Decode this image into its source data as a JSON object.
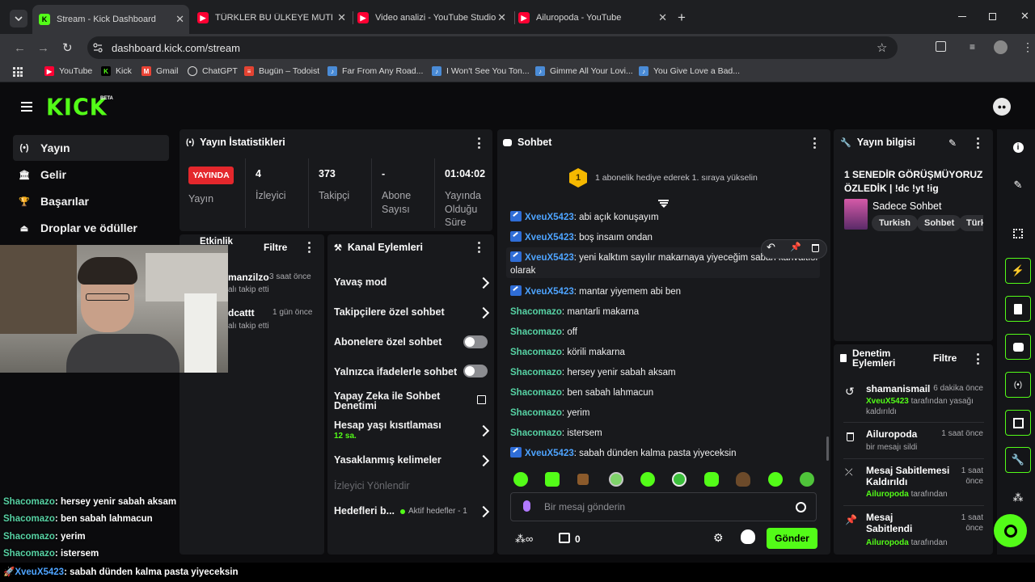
{
  "browser": {
    "tabs": [
      {
        "title": "Stream - Kick Dashboard",
        "icon": "kick-icon"
      },
      {
        "title": "TÜRKLER BU ÜLKEYE MUTLAKA",
        "icon": "youtube-icon"
      },
      {
        "title": "Video analizi - YouTube Studio",
        "icon": "youtube-icon"
      },
      {
        "title": "Ailuropoda - YouTube",
        "icon": "youtube-icon"
      }
    ],
    "url": "dashboard.kick.com/stream",
    "bookmarks": [
      "YouTube",
      "Kick",
      "Gmail",
      "ChatGPT",
      "Bugün – Todoist",
      "Far From Any Road...",
      "I Won't See You Ton...",
      "Gimme All Your Lovi...",
      "You Give Love a Bad..."
    ]
  },
  "header": {
    "logo": "KICK",
    "beta": "BETA"
  },
  "sidebar": {
    "items": [
      {
        "label": "Yayın",
        "icon": "broadcast-icon"
      },
      {
        "label": "Gelir",
        "icon": "bank-icon"
      },
      {
        "label": "Başarılar",
        "icon": "trophy-icon"
      },
      {
        "label": "Droplar ve ödüller",
        "icon": "drops-icon"
      }
    ]
  },
  "stats": {
    "title": "Yayın İstatistikleri",
    "live_badge": "YAYINDA",
    "live_label": "Yayın",
    "items": [
      {
        "value": "4",
        "label": "İzleyici"
      },
      {
        "value": "373",
        "label": "Takipçi"
      },
      {
        "value": "-",
        "label": "Abone Sayısı"
      },
      {
        "value": "01:04:02",
        "label": "Yayında Olduğu Süre"
      }
    ]
  },
  "activity": {
    "title": "Etkinlik",
    "filter": "Filtre",
    "items": [
      {
        "name": "manzilzo",
        "time": "3 saat önce",
        "action": "alı takip etti"
      },
      {
        "name": "dcattt",
        "time": "1 gün önce",
        "action": "alı takip etti"
      }
    ]
  },
  "channel_actions": {
    "title": "Kanal Eylemleri",
    "items": [
      {
        "label": "Yavaş mod"
      },
      {
        "label": "Takipçilere özel sohbet"
      },
      {
        "label": "Abonelere özel sohbet"
      },
      {
        "label": "Yalnızca ifadelerle sohbet"
      },
      {
        "label": "Yapay Zeka ile Sohbet Denetimi"
      },
      {
        "label": "Hesap yaşı kısıtlaması",
        "sub": "12 sa."
      },
      {
        "label": "Yasaklanmış kelimeler"
      },
      {
        "label": "İzleyici Yönlendir"
      },
      {
        "label": "Hedefleri b...",
        "sub": "Aktif hedefler - 1"
      }
    ]
  },
  "chat": {
    "title": "Sohbet",
    "gift_rank": "1",
    "gift_text": "1 abonelik hediye ederek 1. sıraya yükselin",
    "messages": [
      {
        "user": "XveuX5423",
        "text": "abi açık konuşayım"
      },
      {
        "user": "XveuX5423",
        "text": "boş insaım ondan"
      },
      {
        "user": "XveuX5423",
        "text": "yeni kalktım sayılır makarnaya yiyeceğim sabah kahvaltısı olarak"
      },
      {
        "user": "XveuX5423",
        "text": "mantar yiyemem abi ben"
      },
      {
        "user": "Shacomazo",
        "text": "mantarli makarna"
      },
      {
        "user": "Shacomazo",
        "text": "off"
      },
      {
        "user": "Shacomazo",
        "text": "körili makarna"
      },
      {
        "user": "Shacomazo",
        "text": "hersey yenir sabah aksam"
      },
      {
        "user": "Shacomazo",
        "text": "ben sabah lahmacun"
      },
      {
        "user": "Shacomazo",
        "text": "yerim"
      },
      {
        "user": "Shacomazo",
        "text": "istersem"
      },
      {
        "user": "XveuX5423",
        "text": "sabah dünden kalma pasta yiyeceksin"
      }
    ],
    "input_placeholder": "Bir mesaj gönderin",
    "points": "0",
    "send_label": "Gönder"
  },
  "stream_info": {
    "title": "Yayın bilgisi",
    "stream_title": "1 SENEDİR GÖRÜŞMÜYORUZ ÖZLEDİK | !dc !yt !ig",
    "category": "Sadece Sohbet",
    "tags": [
      "Turkish",
      "Sohbet",
      "Türk"
    ]
  },
  "moderation": {
    "title": "Denetim Eylemleri",
    "filter": "Filtre",
    "items": [
      {
        "title": "shamanismail",
        "time": "6 dakika önce",
        "user": "XveuX5423",
        "sub": "tarafından yasağı kaldırıldı",
        "icon": "undo-icon"
      },
      {
        "title": "Ailuropoda",
        "time": "1 saat önce",
        "user": "",
        "sub": "bir mesajı sildi",
        "icon": "trash-icon"
      },
      {
        "title": "Mesaj Sabitlemesi Kaldırıldı",
        "time": "1 saat önce",
        "user": "Ailuropoda",
        "sub": "tarafından",
        "icon": "unpin-icon"
      },
      {
        "title": "Mesaj Sabitlendi",
        "time": "1 saat önce",
        "user": "Ailuropoda",
        "sub": "tarafından",
        "icon": "pin-icon"
      }
    ]
  },
  "overlay": {
    "messages": [
      {
        "user": "Shacomazo",
        "text": "hersey yenir sabah aksam"
      },
      {
        "user": "Shacomazo",
        "text": "ben sabah lahmacun"
      },
      {
        "user": "Shacomazo",
        "text": "yerim"
      },
      {
        "user": "Shacomazo",
        "text": "istersem"
      },
      {
        "user": "XveuX5423",
        "text": "sabah dünden kalma pasta yiyeceksin"
      }
    ]
  },
  "colors": {
    "accent": "#53fc18",
    "panel": "#18191c",
    "background": "#0b0b0d",
    "username_blue": "#4ea4ff",
    "username_teal": "#57d2a4"
  }
}
